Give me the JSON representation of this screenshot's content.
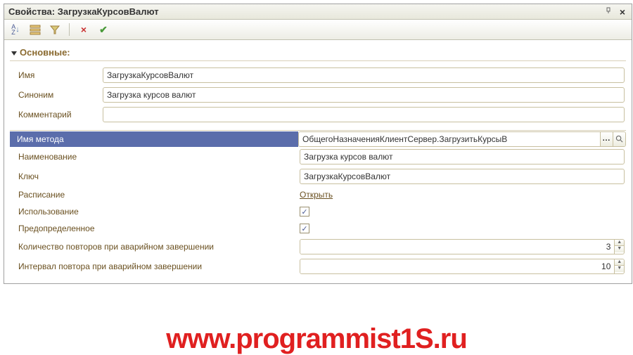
{
  "window": {
    "title": "Свойства: ЗагрузкаКурсовВалют"
  },
  "section": {
    "main": "Основные:"
  },
  "labels": {
    "name": "Имя",
    "synonym": "Синоним",
    "comment": "Комментарий",
    "method_name": "Имя метода",
    "title": "Наименование",
    "key": "Ключ",
    "schedule": "Расписание",
    "usage": "Использование",
    "predefined": "Предопределенное",
    "retry_count": "Количество повторов при аварийном завершении",
    "retry_interval": "Интервал повтора при аварийном завершении"
  },
  "values": {
    "name": "ЗагрузкаКурсовВалют",
    "synonym": "Загрузка курсов валют",
    "comment": "",
    "method_name": "ОбщегоНазначенияКлиентСервер.ЗагрузитьКурсыВ",
    "title": "Загрузка курсов валют",
    "key": "ЗагрузкаКурсовВалют",
    "schedule_link": "Открыть",
    "usage_checked": "✓",
    "predefined_checked": "✓",
    "retry_count": "3",
    "retry_interval": "10"
  },
  "watermark": "www.programmist1S.ru"
}
